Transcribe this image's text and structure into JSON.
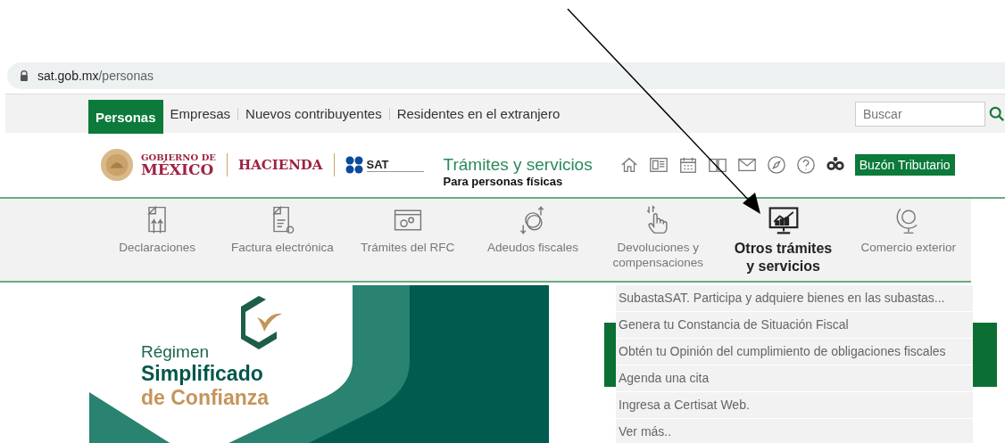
{
  "address_bar": {
    "host": "sat.gob.mx",
    "path": "/personas"
  },
  "top_tabs": [
    {
      "label": "Personas",
      "selected": true
    },
    {
      "label": "Empresas",
      "selected": false
    },
    {
      "label": "Nuevos contribuyentes",
      "selected": false
    },
    {
      "label": "Residentes en el extranjero",
      "selected": false
    }
  ],
  "search": {
    "placeholder": "Buscar"
  },
  "header": {
    "logos": [
      {
        "line1": "GOBIERNO DE",
        "line2": "MÉXICO"
      },
      {
        "name": "HACIENDA"
      },
      {
        "name": "SAT"
      }
    ],
    "title": "Trámites y servicios",
    "subtitle": "Para personas físicas",
    "mailbox_button": "Buzón Tributario"
  },
  "nav": [
    {
      "label": "Declaraciones",
      "selected": false
    },
    {
      "label": "Factura electrónica",
      "selected": false
    },
    {
      "label": "Trámites del RFC",
      "selected": false
    },
    {
      "label": "Adeudos fiscales",
      "selected": false
    },
    {
      "label": "Devoluciones y compensaciones",
      "selected": false
    },
    {
      "label": "Otros trámites y servicios",
      "selected": true
    },
    {
      "label": "Comercio exterior",
      "selected": false
    }
  ],
  "banner": {
    "line1": "Régimen",
    "line2": "Simplificado",
    "line3": "de Confianza"
  },
  "dropdown": [
    "SubastaSAT. Participa y adquiere bienes en las subastas...",
    "Genera tu Constancia de Situación Fiscal",
    "Obtén tu Opinión del cumplimiento de obligaciones fiscales",
    "Agenda una cita",
    "Ingresa a Certisat Web.",
    "Ver más.."
  ]
}
